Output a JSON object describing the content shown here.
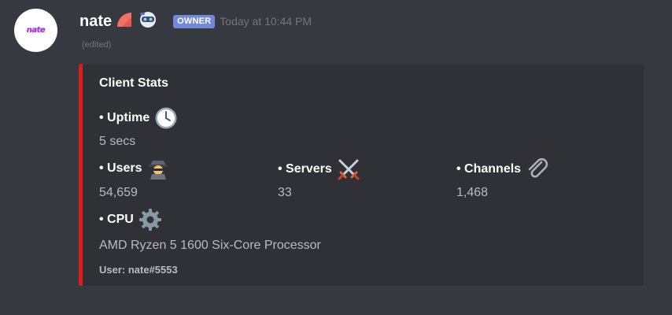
{
  "message": {
    "avatar_text": "nate",
    "author": "nate",
    "role_badge": "OWNER",
    "timestamp": "Today at 10:44 PM",
    "edited_label": "(edited)"
  },
  "embed": {
    "accent_color": "#e01b1b",
    "title": "Client Stats",
    "fields": [
      {
        "name": "• Uptime",
        "value": "5 secs",
        "emoji": "clock-icon"
      },
      {
        "name": "• Users",
        "value": "54,659",
        "emoji": "detective-icon"
      },
      {
        "name": "• Servers",
        "value": "33",
        "emoji": "crossed-swords-icon"
      },
      {
        "name": "• Channels",
        "value": "1,468",
        "emoji": "paperclip-icon"
      },
      {
        "name": "• CPU",
        "value": "AMD Ryzen 5 1600 Six-Core Processor",
        "emoji": "gear-icon"
      }
    ],
    "footer": "User: nate#5553"
  },
  "colors": {
    "background": "#36393f",
    "embed_background": "#2f3136",
    "owner_badge": "#7289da"
  }
}
